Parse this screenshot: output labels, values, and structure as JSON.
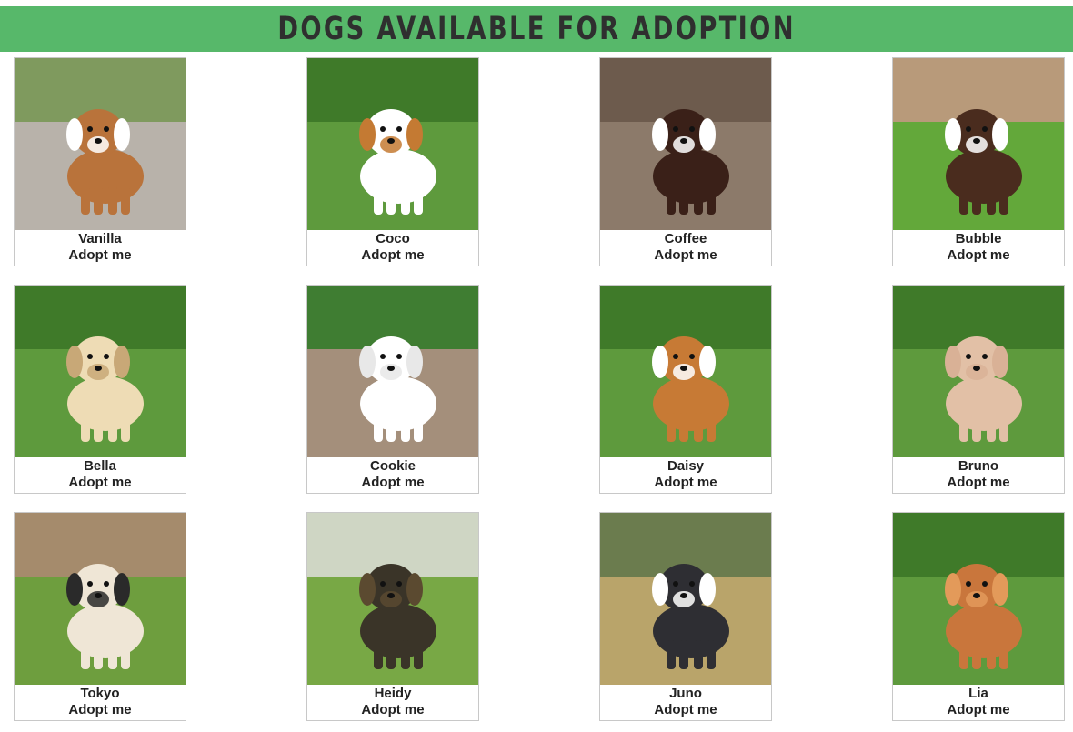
{
  "header": {
    "title": "DOGS AVAILABLE FOR ADOPTION"
  },
  "colors": {
    "banner": "#57b86a"
  },
  "dogs": [
    {
      "name": "Vanilla",
      "adopt_label": "Adopt me",
      "bg": "road",
      "dog": "#b9733b",
      "accent": "#ffffff"
    },
    {
      "name": "Coco",
      "adopt_label": "Adopt me",
      "bg": "grass",
      "dog": "#ffffff",
      "accent": "#c47a33"
    },
    {
      "name": "Coffee",
      "adopt_label": "Adopt me",
      "bg": "steps",
      "dog": "#3a2018",
      "accent": "#ffffff"
    },
    {
      "name": "Bubble",
      "adopt_label": "Adopt me",
      "bg": "grass-wall",
      "dog": "#4a2c1e",
      "accent": "#ffffff"
    },
    {
      "name": "Bella",
      "adopt_label": "Adopt me",
      "bg": "grass",
      "dog": "#eedcb5",
      "accent": "#c8a877"
    },
    {
      "name": "Cookie",
      "adopt_label": "Adopt me",
      "bg": "wood",
      "dog": "#ffffff",
      "accent": "#e8e8e8"
    },
    {
      "name": "Daisy",
      "adopt_label": "Adopt me",
      "bg": "grass",
      "dog": "#c77a35",
      "accent": "#ffffff"
    },
    {
      "name": "Bruno",
      "adopt_label": "Adopt me",
      "bg": "grass",
      "dog": "#e2c0a6",
      "accent": "#d9b196"
    },
    {
      "name": "Tokyo",
      "adopt_label": "Adopt me",
      "bg": "park",
      "dog": "#efe6d6",
      "accent": "#2a2a2a"
    },
    {
      "name": "Heidy",
      "adopt_label": "Adopt me",
      "bg": "field",
      "dog": "#3a3428",
      "accent": "#5b4a30"
    },
    {
      "name": "Juno",
      "adopt_label": "Adopt me",
      "bg": "blur",
      "dog": "#2e2e33",
      "accent": "#ffffff"
    },
    {
      "name": "Lia",
      "adopt_label": "Adopt me",
      "bg": "grass",
      "dog": "#c9763c",
      "accent": "#e39a5a"
    }
  ]
}
